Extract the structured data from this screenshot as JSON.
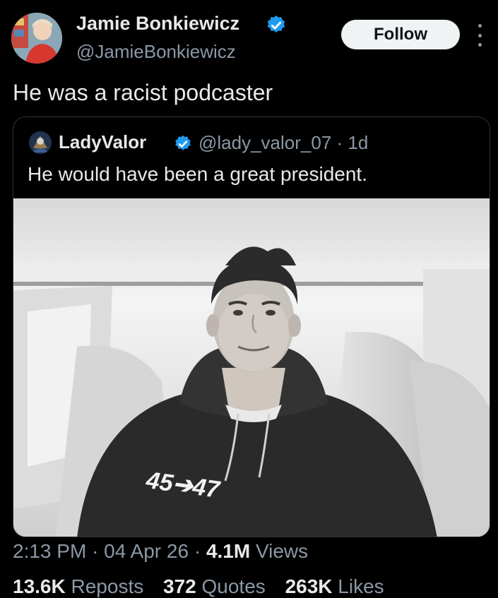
{
  "author": {
    "name": "Jamie Bonkiewicz",
    "handle": "@JamieBonkiewicz",
    "verified": true
  },
  "follow_label": "Follow",
  "more_icon": "more-vertical-icon",
  "tweet_text": "He was a racist podcaster",
  "quote": {
    "name": "LadyValor",
    "handle": "@lady_valor_07",
    "separator": "·",
    "age": "1d",
    "text": "He would have been a great president.",
    "photo_hoodie_text": "45➔47"
  },
  "meta": {
    "time": "2:13 PM",
    "date": "04 Apr 26",
    "separator": "·",
    "views_count": "4.1M",
    "views_label": "Views"
  },
  "stats": {
    "reposts_count": "13.6K",
    "reposts_label": "Reposts",
    "quotes_count": "372",
    "quotes_label": "Quotes",
    "likes_count": "263K",
    "likes_label": "Likes"
  },
  "colors": {
    "background": "#000000",
    "text_primary": "#e7e9ea",
    "text_secondary": "#8b98a5",
    "verified_blue": "#1d9bf0",
    "border": "#2f3336",
    "button_bg": "#eff3f4"
  }
}
